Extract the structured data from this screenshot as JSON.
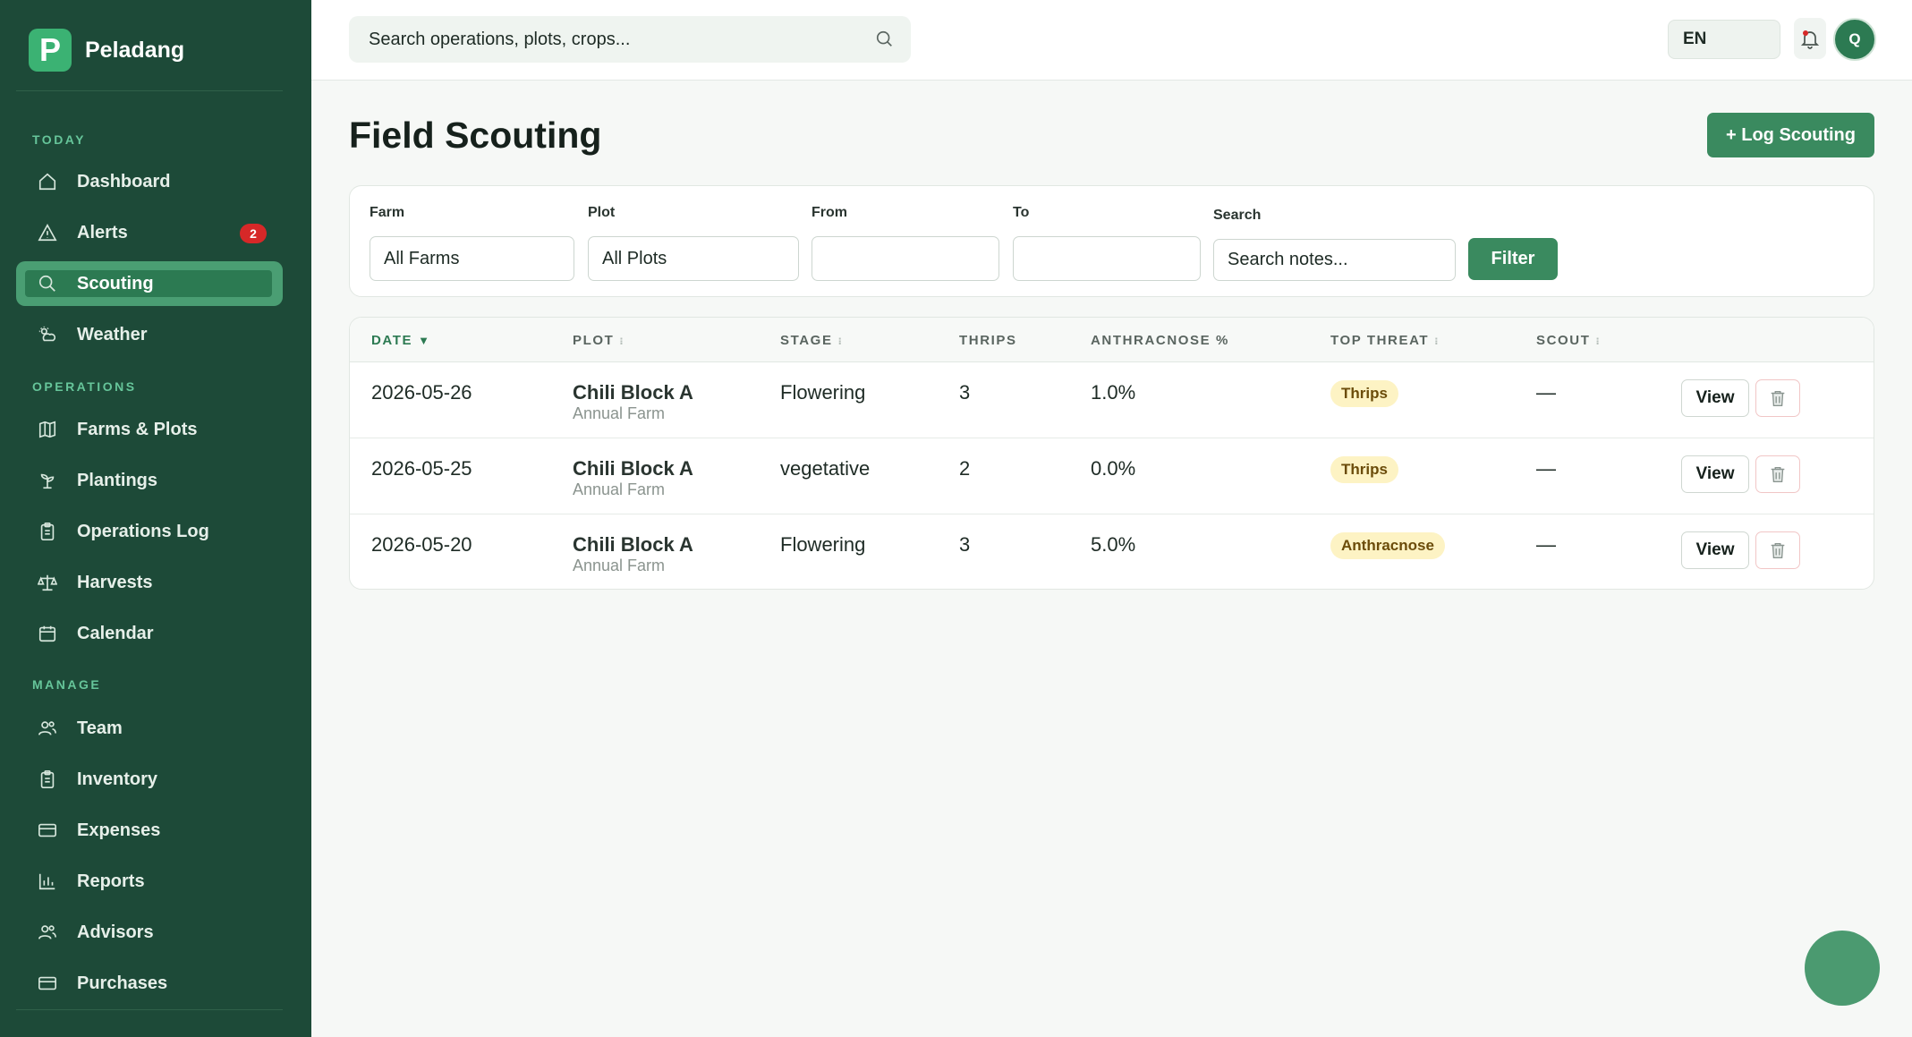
{
  "brand": {
    "logo_letter": "P",
    "name": "Peladang"
  },
  "sidebar": {
    "sections": [
      {
        "label": "TODAY",
        "items": [
          {
            "label": "Dashboard",
            "icon": "home-icon"
          },
          {
            "label": "Alerts",
            "icon": "warning-icon",
            "badge": "2"
          },
          {
            "label": "Scouting",
            "icon": "search-icon",
            "active": true
          },
          {
            "label": "Weather",
            "icon": "weather-icon"
          }
        ]
      },
      {
        "label": "OPERATIONS",
        "items": [
          {
            "label": "Farms & Plots",
            "icon": "map-icon"
          },
          {
            "label": "Plantings",
            "icon": "sprout-icon"
          },
          {
            "label": "Operations Log",
            "icon": "clipboard-icon"
          },
          {
            "label": "Harvests",
            "icon": "scale-icon"
          },
          {
            "label": "Calendar",
            "icon": "calendar-icon"
          }
        ]
      },
      {
        "label": "MANAGE",
        "items": [
          {
            "label": "Team",
            "icon": "users-icon"
          },
          {
            "label": "Inventory",
            "icon": "clipboard-icon"
          },
          {
            "label": "Expenses",
            "icon": "card-icon"
          },
          {
            "label": "Reports",
            "icon": "bar-chart-icon"
          },
          {
            "label": "Advisors",
            "icon": "users-icon"
          },
          {
            "label": "Purchases",
            "icon": "card-icon"
          }
        ]
      }
    ]
  },
  "topbar": {
    "search_placeholder": "Search operations, plots, crops...",
    "language": "EN",
    "avatar_initial": "Q"
  },
  "page": {
    "title": "Field Scouting",
    "log_button": "+ Log Scouting"
  },
  "filters": {
    "farm_label": "Farm",
    "farm_value": "All Farms",
    "plot_label": "Plot",
    "plot_value": "All Plots",
    "from_label": "From",
    "from_value": "",
    "to_label": "To",
    "to_value": "",
    "search_label": "Search",
    "search_placeholder": "Search notes...",
    "filter_button": "Filter"
  },
  "table": {
    "columns": {
      "date": "DATE",
      "plot": "PLOT",
      "stage": "STAGE",
      "thrips": "THRIPS",
      "anthracnose": "ANTHRACNOSE %",
      "top_threat": "TOP THREAT",
      "scout": "SCOUT"
    },
    "sort_desc_glyph": "▼",
    "sort_glyph": "⁝",
    "rows": [
      {
        "date": "2026-05-26",
        "plot": "Chili Block A",
        "farm": "Annual Farm",
        "stage": "Flowering",
        "thrips": "3",
        "anthracnose": "1.0%",
        "threat": "Thrips",
        "scout": "—",
        "view": "View"
      },
      {
        "date": "2026-05-25",
        "plot": "Chili Block A",
        "farm": "Annual Farm",
        "stage": "vegetative",
        "thrips": "2",
        "anthracnose": "0.0%",
        "threat": "Thrips",
        "scout": "—",
        "view": "View"
      },
      {
        "date": "2026-05-20",
        "plot": "Chili Block A",
        "farm": "Annual Farm",
        "stage": "Flowering",
        "thrips": "3",
        "anthracnose": "5.0%",
        "threat": "Anthracnose",
        "scout": "—",
        "view": "View"
      }
    ]
  }
}
